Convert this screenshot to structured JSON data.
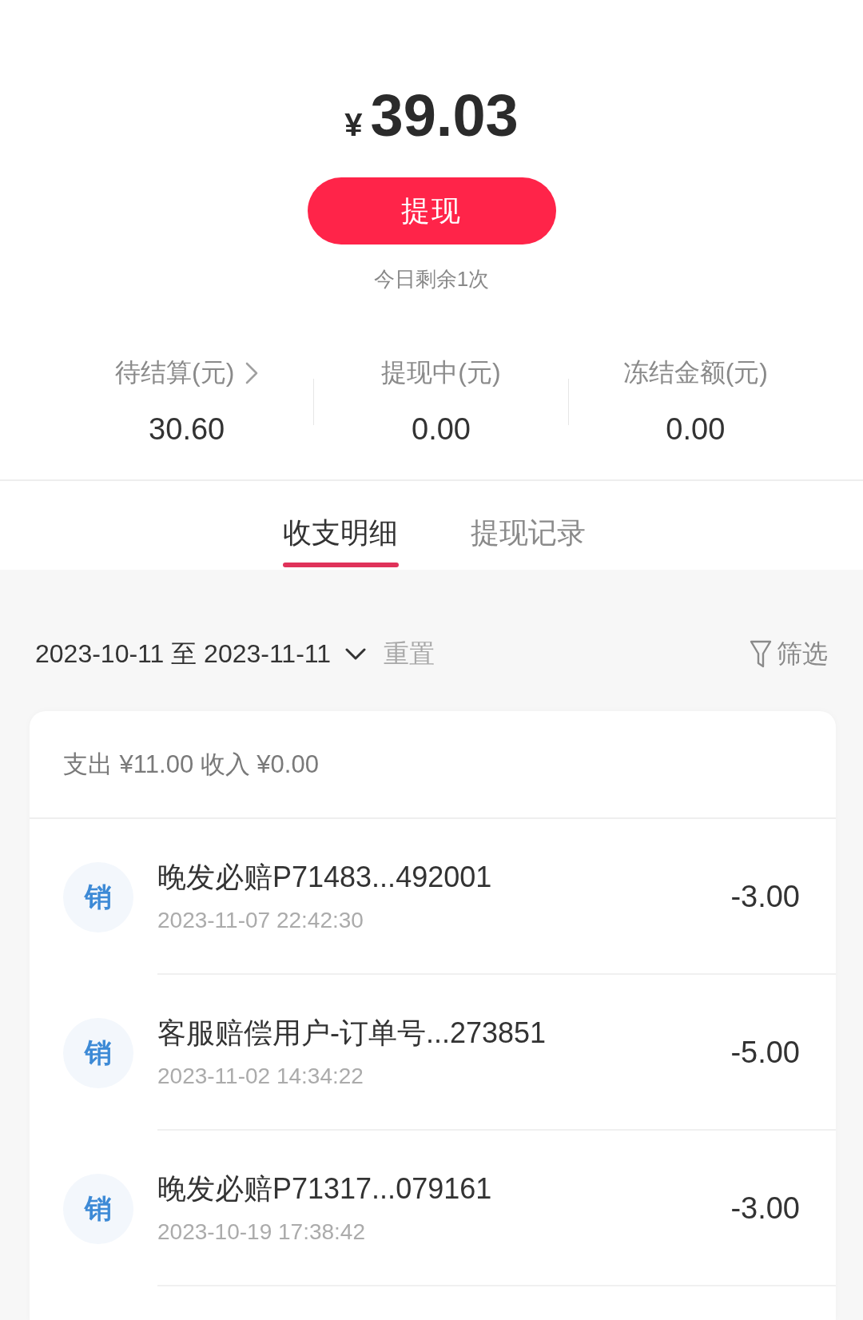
{
  "balance": {
    "currency": "¥",
    "amount": "39.03"
  },
  "withdraw_button": {
    "label": "提现"
  },
  "remaining_note": "今日剩余1次",
  "stats": [
    {
      "label": "待结算(元)",
      "value": "30.60",
      "kind": "link"
    },
    {
      "label": "提现中(元)",
      "value": "0.00",
      "kind": "plain"
    },
    {
      "label": "冻结金额(元)",
      "value": "0.00",
      "kind": "plain"
    }
  ],
  "tabs": [
    {
      "label": "收支明细",
      "selected": true
    },
    {
      "label": "提现记录",
      "selected": false
    }
  ],
  "filter": {
    "date_range": "2023-10-11 至 2023-11-11",
    "reset": "重置",
    "filter_label": "筛选"
  },
  "summary": "支出 ¥11.00 收入 ¥0.00",
  "transactions": [
    {
      "badge": "销",
      "title": "晚发必赔P71483...492001",
      "time": "2023-11-07 22:42:30",
      "amount": "-3.00"
    },
    {
      "badge": "销",
      "title": "客服赔偿用户-订单号...273851",
      "time": "2023-11-02 14:34:22",
      "amount": "-5.00"
    },
    {
      "badge": "销",
      "title": "晚发必赔P71317...079161",
      "time": "2023-10-19 17:38:42",
      "amount": "-3.00"
    }
  ]
}
